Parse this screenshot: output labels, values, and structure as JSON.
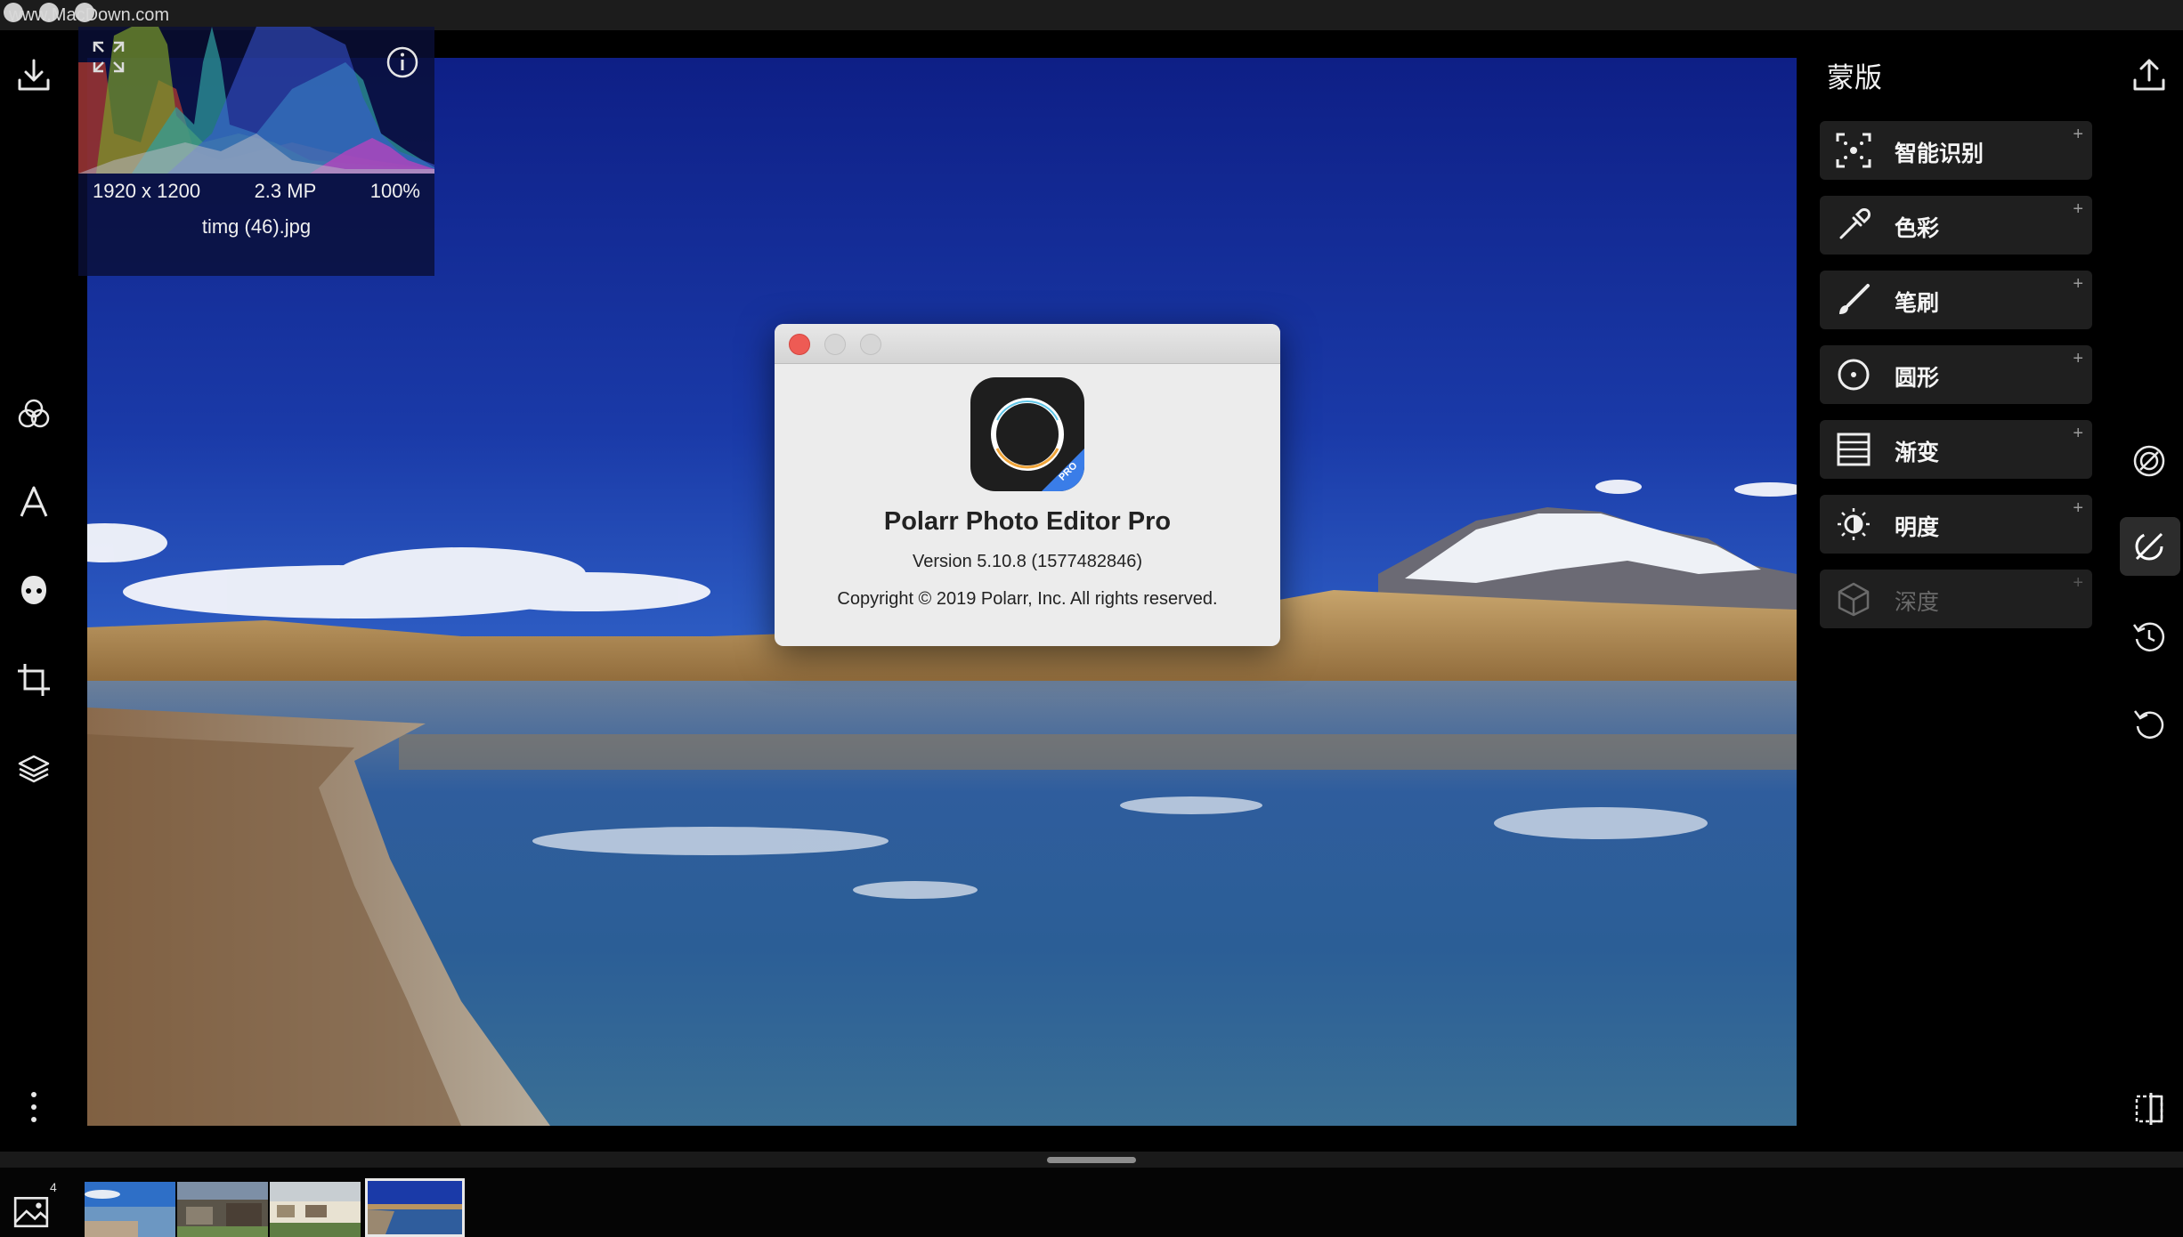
{
  "window": {
    "watermark": "www.MacDown.com"
  },
  "histogram_panel": {
    "dimensions": "1920 x 1200",
    "megapixels": "2.3 MP",
    "zoom": "100%",
    "filename": "timg (46).jpg",
    "expand_icon": "expand-icon",
    "info_icon": "info-icon"
  },
  "left_toolbar": {
    "items": [
      "download-icon",
      "filters-icon",
      "text-icon",
      "face-icon",
      "crop-icon",
      "layers-icon",
      "more-icon"
    ]
  },
  "about_dialog": {
    "app_name": "Polarr Photo Editor Pro",
    "version": "Version 5.10.8 (1577482846)",
    "copyright": "Copyright © 2019 Polarr, Inc. All rights reserved.",
    "icon_badge": "PRO"
  },
  "mask_panel": {
    "title": "蒙版",
    "plus": "+",
    "items": [
      {
        "label": "智能识别",
        "icon": "smart-detect-icon",
        "enabled": true
      },
      {
        "label": "色彩",
        "icon": "eyedropper-icon",
        "enabled": true
      },
      {
        "label": "笔刷",
        "icon": "brush-icon",
        "enabled": true
      },
      {
        "label": "圆形",
        "icon": "circle-icon",
        "enabled": true
      },
      {
        "label": "渐变",
        "icon": "gradient-icon",
        "enabled": true
      },
      {
        "label": "明度",
        "icon": "brightness-icon",
        "enabled": true
      },
      {
        "label": "深度",
        "icon": "depth-cube-icon",
        "enabled": false
      }
    ]
  },
  "right_toolbar": {
    "items": [
      "export-icon",
      "adjust-icon",
      "mask-icon",
      "history-icon",
      "reset-icon",
      "compare-icon"
    ]
  },
  "filmstrip": {
    "count_badge": "4",
    "thumbnails": 4,
    "selected_index": 3
  },
  "colors": {
    "background": "#000000",
    "panel_item": "#1f1f1f",
    "close_red": "#ee5b54",
    "accent_blue": "#3a7de8"
  }
}
